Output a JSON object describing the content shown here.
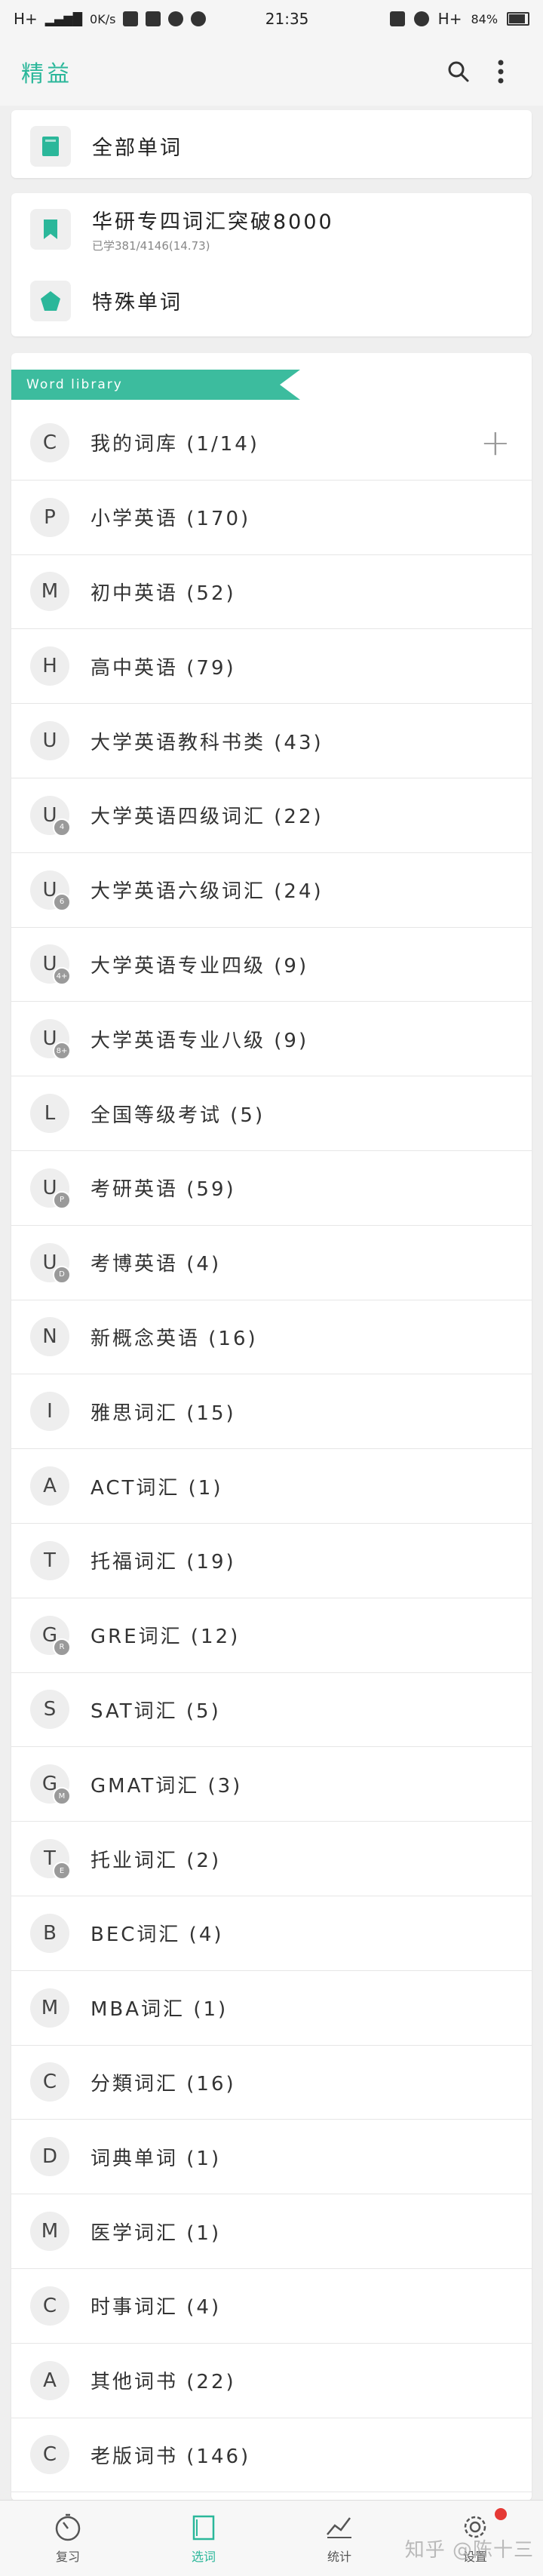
{
  "status_bar": {
    "network": "H+",
    "speed": "0K/s",
    "time": "21:35",
    "network2": "H+",
    "battery": "84%"
  },
  "app_bar": {
    "title": "精益"
  },
  "top_card": {
    "all_words_label": "全部单词"
  },
  "book_card": {
    "book_title": "华研专四词汇突破8000",
    "book_progress": "已学381/4146(14.73)",
    "special_words_label": "特殊单词"
  },
  "library": {
    "tag_label": "Word library",
    "items": [
      {
        "letter": "C",
        "badge": "",
        "name": "我的词库 (1/14)"
      },
      {
        "letter": "P",
        "badge": "",
        "name": "小学英语 (170)"
      },
      {
        "letter": "M",
        "badge": "",
        "name": "初中英语 (52)"
      },
      {
        "letter": "H",
        "badge": "",
        "name": "高中英语 (79)"
      },
      {
        "letter": "U",
        "badge": "",
        "name": "大学英语教科书类 (43)"
      },
      {
        "letter": "U",
        "badge": "4",
        "name": "大学英语四级词汇 (22)"
      },
      {
        "letter": "U",
        "badge": "6",
        "name": "大学英语六级词汇 (24)"
      },
      {
        "letter": "U",
        "badge": "4+",
        "name": "大学英语专业四级 (9)"
      },
      {
        "letter": "U",
        "badge": "8+",
        "name": "大学英语专业八级 (9)"
      },
      {
        "letter": "L",
        "badge": "",
        "name": "全国等级考试 (5)"
      },
      {
        "letter": "U",
        "badge": "P",
        "name": "考研英语 (59)"
      },
      {
        "letter": "U",
        "badge": "D",
        "name": "考博英语 (4)"
      },
      {
        "letter": "N",
        "badge": "",
        "name": "新概念英语 (16)"
      },
      {
        "letter": "I",
        "badge": "",
        "name": "雅思词汇 (15)"
      },
      {
        "letter": "A",
        "badge": "",
        "name": "ACT词汇 (1)"
      },
      {
        "letter": "T",
        "badge": "",
        "name": "托福词汇 (19)"
      },
      {
        "letter": "G",
        "badge": "R",
        "name": "GRE词汇 (12)"
      },
      {
        "letter": "S",
        "badge": "",
        "name": "SAT词汇 (5)"
      },
      {
        "letter": "G",
        "badge": "M",
        "name": "GMAT词汇 (3)"
      },
      {
        "letter": "T",
        "badge": "E",
        "name": "托业词汇 (2)"
      },
      {
        "letter": "B",
        "badge": "",
        "name": "BEC词汇 (4)"
      },
      {
        "letter": "M",
        "badge": "",
        "name": "MBA词汇 (1)"
      },
      {
        "letter": "C",
        "badge": "",
        "name": "分類词汇 (16)"
      },
      {
        "letter": "D",
        "badge": "",
        "name": "词典单词 (1)"
      },
      {
        "letter": "M",
        "badge": "",
        "name": "医学词汇 (1)"
      },
      {
        "letter": "C",
        "badge": "",
        "name": "时事词汇 (4)"
      },
      {
        "letter": "A",
        "badge": "",
        "name": "其他词书 (22)"
      },
      {
        "letter": "C",
        "badge": "",
        "name": "老版词书 (146)"
      }
    ]
  },
  "bottom_nav": {
    "review": "复习",
    "words": "选词",
    "stats": "统计",
    "settings": "设置"
  },
  "watermark": "知乎 @陈十三",
  "colors": {
    "accent": "#2bb79a",
    "tag": "#3cbc9e",
    "notification": "#e53935"
  }
}
